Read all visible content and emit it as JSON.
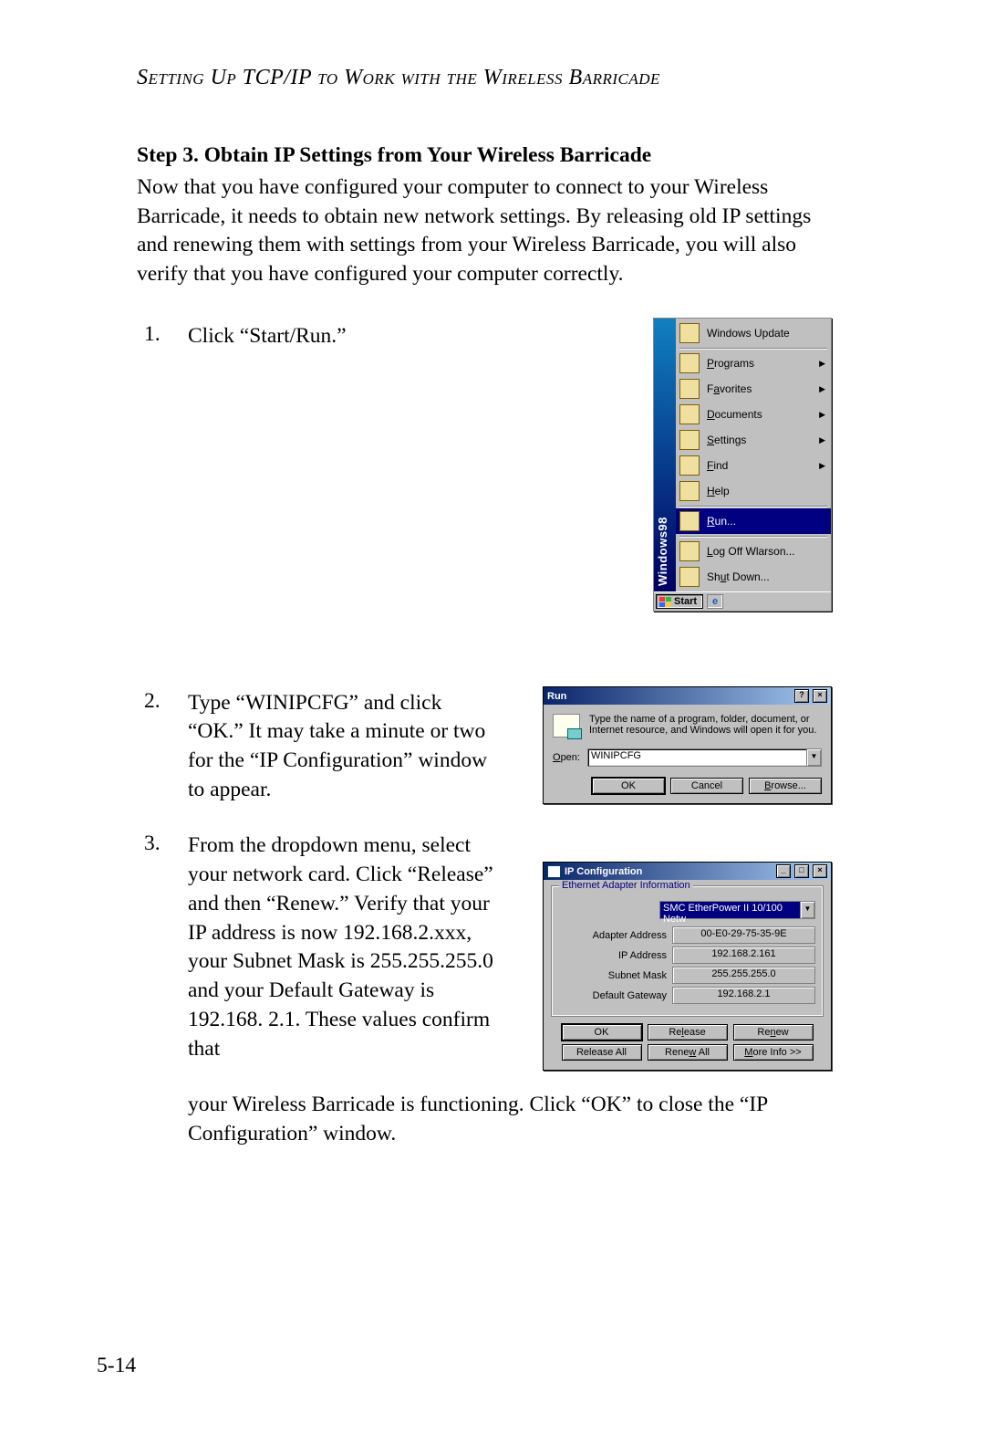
{
  "header": {
    "title": "Setting Up TCP/IP to Work with the Wireless Barricade"
  },
  "step": {
    "heading": "Step 3. Obtain IP Settings from Your Wireless Barricade"
  },
  "intro": "Now that you have configured your computer to connect to your Wireless Barricade, it needs to obtain new network settings. By releasing old IP settings and renewing them with settings from your Wireless Barricade, you will also verify that you have configured your computer correctly.",
  "list": {
    "n1": "1.",
    "t1": "Click “Start/Run.”",
    "n2": "2.",
    "t2": "Type “WINIPCFG” and click “OK.” It may take a minute or two for the “IP Configuration” window to appear.",
    "n3": "3.",
    "t3": "From the dropdown menu, select your network card. Click “Release” and then “Renew.” Verify that your IP address is now 192.168.2.xxx, your Subnet Mask is 255.255.255.0 and your Default Gateway is 192.168. 2.1. These values confirm that",
    "t3cont": "your Wireless Barricade is functioning. Click “OK” to close the “IP Configuration” window."
  },
  "startmenu": {
    "stripe_brand": "Windows",
    "stripe_ver": "98",
    "items": [
      {
        "label": "Windows Update",
        "accel": "",
        "arrow": false,
        "sel": false
      },
      {
        "label": "Programs",
        "accel": "P",
        "arrow": true,
        "sel": false
      },
      {
        "label": "Favorites",
        "accel": "a",
        "arrow": true,
        "sel": false
      },
      {
        "label": "Documents",
        "accel": "D",
        "arrow": true,
        "sel": false
      },
      {
        "label": "Settings",
        "accel": "S",
        "arrow": true,
        "sel": false
      },
      {
        "label": "Find",
        "accel": "F",
        "arrow": true,
        "sel": false
      },
      {
        "label": "Help",
        "accel": "H",
        "arrow": false,
        "sel": false
      },
      {
        "label": "Run...",
        "accel": "R",
        "arrow": false,
        "sel": true
      },
      {
        "label": "Log Off Wlarson...",
        "accel": "L",
        "arrow": false,
        "sel": false
      },
      {
        "label": "Shut Down...",
        "accel": "u",
        "arrow": false,
        "sel": false
      }
    ],
    "start_label": "Start"
  },
  "rundlg": {
    "title": "Run",
    "message": "Type the name of a program, folder, document, or Internet resource, and Windows will open it for you.",
    "open_label": "Open:",
    "open_accel": "O",
    "open_value": "WINIPCFG",
    "ok": "OK",
    "cancel": "Cancel",
    "browse": "Browse...",
    "browse_accel": "B"
  },
  "ipcfg": {
    "title": "IP Configuration",
    "group": "Ethernet Adapter Information",
    "adapter": "SMC EtherPower II 10/100 Netw",
    "fields": {
      "adapter_address_label": "Adapter Address",
      "adapter_address_value": "00-E0-29-75-35-9E",
      "ip_address_label": "IP Address",
      "ip_address_value": "192.168.2.161",
      "subnet_mask_label": "Subnet Mask",
      "subnet_mask_value": "255.255.255.0",
      "default_gateway_label": "Default Gateway",
      "default_gateway_value": "192.168.2.1"
    },
    "buttons": {
      "ok": "OK",
      "release": "Release",
      "renew": "Renew",
      "release_all": "Release All",
      "renew_all": "Renew All",
      "more_info": "More Info >>"
    },
    "btn_accels": {
      "release": "l",
      "renew": "n",
      "renew_all": "w",
      "more_info": "M"
    }
  },
  "page_number": "5-14"
}
